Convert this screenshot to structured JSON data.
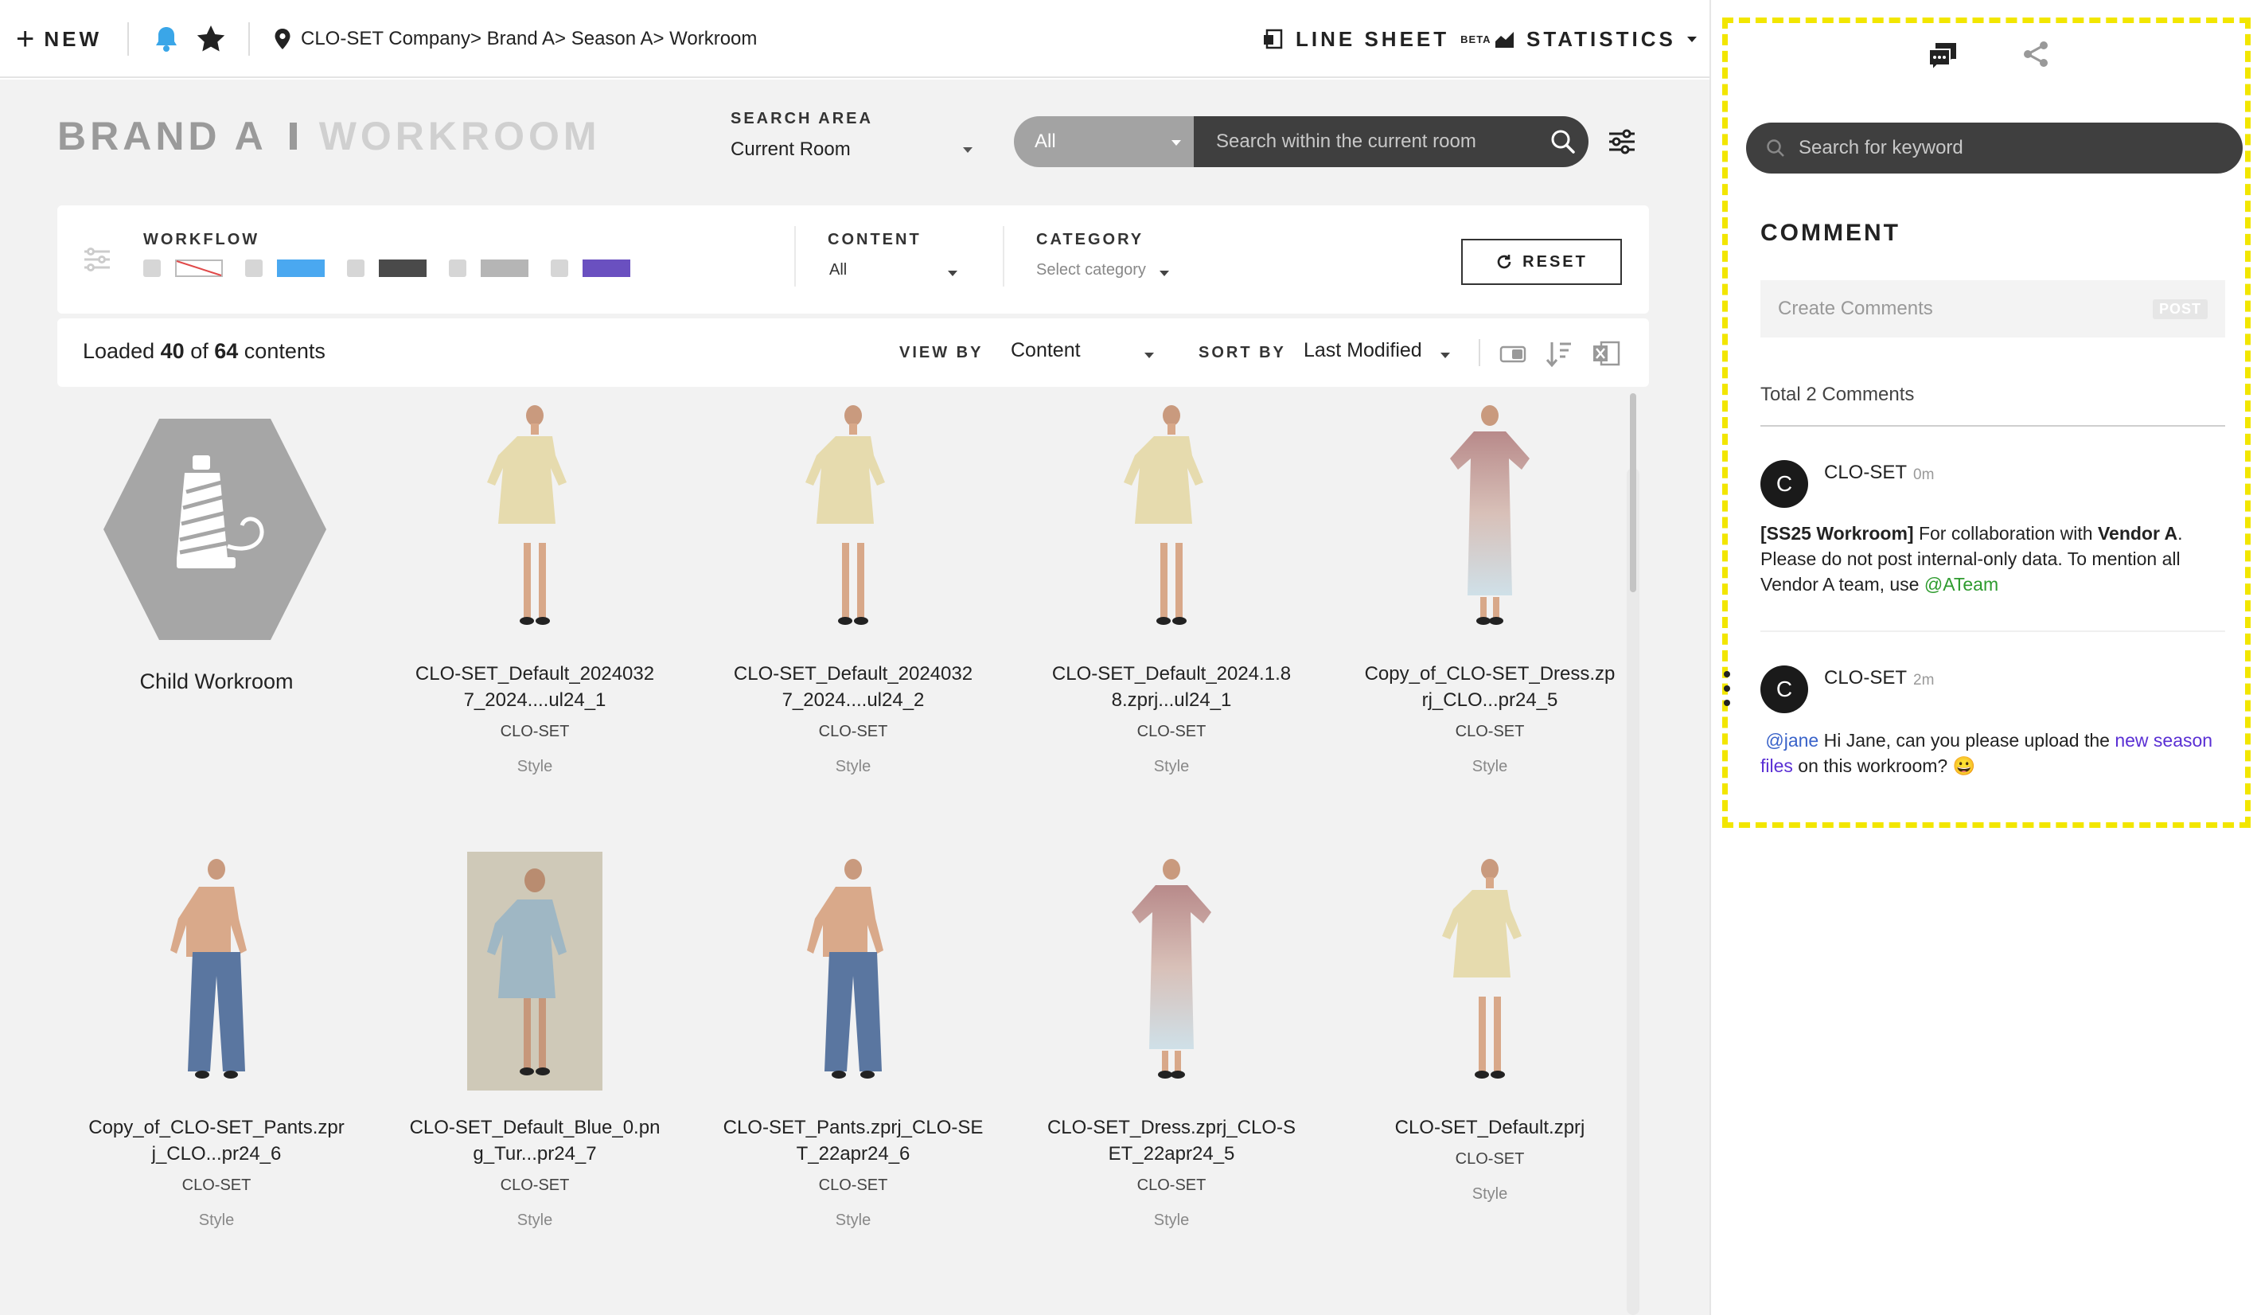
{
  "topbar": {
    "new_label": "NEW",
    "breadcrumb": "CLO-SET Company> Brand A> Season A> Workroom",
    "line_sheet_label": "LINE SHEET",
    "line_sheet_badge": "BETA",
    "statistics_label": "STATISTICS"
  },
  "room": {
    "brand": "BRAND A",
    "name": "WORKROOM"
  },
  "search_area": {
    "label": "SEARCH AREA",
    "value": "Current Room"
  },
  "search": {
    "scope": "All",
    "placeholder": "Search within the current room"
  },
  "filters": {
    "workflow_label": "WORKFLOW",
    "workflow_colors": [
      "none",
      "#4aa8f0",
      "#4a4a4a",
      "#b5b5b5",
      "#6a50c0"
    ],
    "content_label": "CONTENT",
    "content_value": "All",
    "category_label": "CATEGORY",
    "category_placeholder": "Select category",
    "reset_label": "RESET"
  },
  "toolbar": {
    "loaded_prefix": "Loaded",
    "loaded_count": "40",
    "loaded_of": "of",
    "loaded_total": "64",
    "loaded_suffix": "contents",
    "view_by_label": "VIEW BY",
    "view_by_value": "Content",
    "sort_by_label": "SORT BY",
    "sort_by_value": "Last Modified"
  },
  "items": [
    {
      "name_line1": "Child Workroom",
      "name_line2": "",
      "owner": "",
      "type": "",
      "kind": "folder"
    },
    {
      "name_line1": "CLO-SET_Default_2024032",
      "name_line2": "7_2024....ul24_1",
      "owner": "CLO-SET",
      "type": "Style",
      "kind": "dress"
    },
    {
      "name_line1": "CLO-SET_Default_2024032",
      "name_line2": "7_2024....ul24_2",
      "owner": "CLO-SET",
      "type": "Style",
      "kind": "dress"
    },
    {
      "name_line1": "CLO-SET_Default_2024.1.8",
      "name_line2": "8.zprj...ul24_1",
      "owner": "CLO-SET",
      "type": "Style",
      "kind": "dress"
    },
    {
      "name_line1": "Copy_of_CLO-SET_Dress.zp",
      "name_line2": "rj_CLO...pr24_5",
      "owner": "CLO-SET",
      "type": "Style",
      "kind": "gradient"
    },
    {
      "name_line1": "Copy_of_CLO-SET_Pants.zpr",
      "name_line2": "j_CLO...pr24_6",
      "owner": "CLO-SET",
      "type": "Style",
      "kind": "pants"
    },
    {
      "name_line1": "CLO-SET_Default_Blue_0.pn",
      "name_line2": "g_Tur...pr24_7",
      "owner": "CLO-SET",
      "type": "Style",
      "kind": "photo"
    },
    {
      "name_line1": "CLO-SET_Pants.zprj_CLO-SE",
      "name_line2": "T_22apr24_6",
      "owner": "CLO-SET",
      "type": "Style",
      "kind": "pants"
    },
    {
      "name_line1": "CLO-SET_Dress.zprj_CLO-S",
      "name_line2": "ET_22apr24_5",
      "owner": "CLO-SET",
      "type": "Style",
      "kind": "gradient"
    },
    {
      "name_line1": "CLO-SET_Default.zprj",
      "name_line2": "",
      "owner": "CLO-SET",
      "type": "Style",
      "kind": "dress"
    }
  ],
  "comments_panel": {
    "keyword_placeholder": "Search for keyword",
    "title": "COMMENT",
    "create_placeholder": "Create Comments",
    "post_label": "POST",
    "total_label": "Total 2 Comments",
    "comments": [
      {
        "avatar": "C",
        "author": "CLO-SET",
        "time": "0m",
        "tag": "[SS25 Workroom]",
        "text1": " For collaboration with ",
        "bold2": "Vendor A",
        "text2": ". Please do not post internal-only data. To mention all Vendor A team, use ",
        "mention": "@ATeam"
      },
      {
        "avatar": "C",
        "author": "CLO-SET",
        "time": "2m",
        "mention": "@jane",
        "text1": "  Hi Jane, can you please upload the ",
        "link": "new season files",
        "text2": " on this workroom? ",
        "emoji": "😀"
      }
    ]
  }
}
